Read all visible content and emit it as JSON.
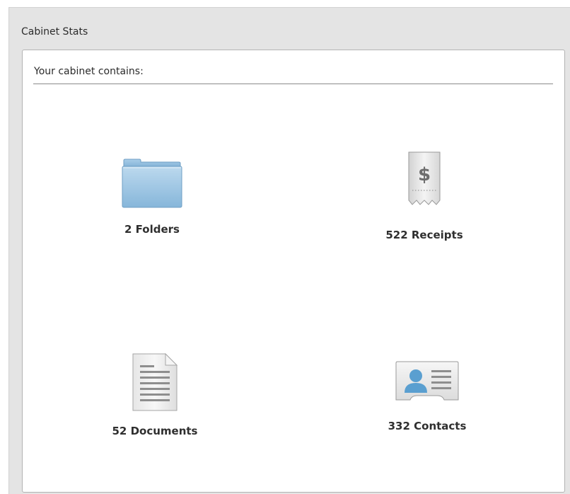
{
  "panel": {
    "title": "Cabinet Stats"
  },
  "content": {
    "heading": "Your cabinet contains:"
  },
  "stats": {
    "folders": {
      "label": "2 Folders",
      "icon": "folder-icon"
    },
    "receipts": {
      "label": "522 Receipts",
      "icon": "receipt-icon"
    },
    "documents": {
      "label": "52 Documents",
      "icon": "document-icon"
    },
    "contacts": {
      "label": "332 Contacts",
      "icon": "contact-card-icon"
    }
  },
  "colors": {
    "panel_bg": "#e4e4e4",
    "folder_blue": "#8fbfe0",
    "contact_blue": "#5a9fd0",
    "icon_gray": "#d9d9d9"
  }
}
